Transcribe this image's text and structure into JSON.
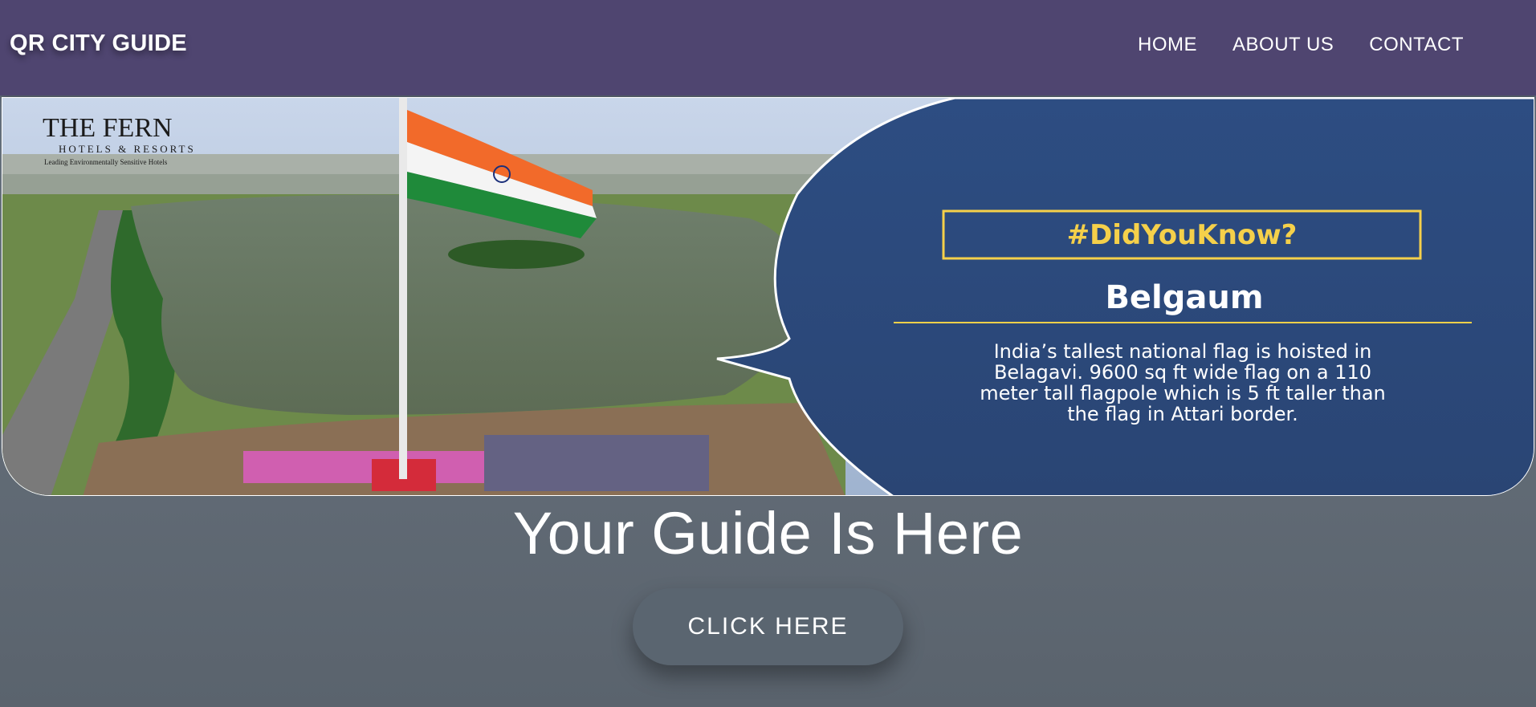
{
  "header": {
    "brand": "QR CITY GUIDE",
    "nav": [
      {
        "label": "HOME"
      },
      {
        "label": "ABOUT US"
      },
      {
        "label": "CONTACT"
      }
    ]
  },
  "banner": {
    "logo_line1": "THE FERN",
    "logo_line2": "HOTELS & RESORTS",
    "logo_line3": "Leading Environmentally Sensitive Hotels",
    "hashtag": "#DidYouKnow?",
    "city": "Belgaum",
    "fact_lines": [
      "India’s tallest national flag is hoisted in",
      "Belagavi. 9600 sq ft wide flag on a 110",
      "meter tall flagpole which is 5 ft taller than",
      "the flag in Attari border."
    ],
    "colors": {
      "saffron": "#f26a2a",
      "green": "#1f8a3a",
      "callout_bg": "#2c4a7c",
      "hashtag_gold": "#f5d04a"
    }
  },
  "hero": {
    "heading": "Your Guide Is Here",
    "button_label": "CLICK HERE"
  },
  "colors": {
    "navbar_bg": "#4f4570",
    "page_bg": "#5f6b79",
    "button_bg": "#5a6570"
  }
}
